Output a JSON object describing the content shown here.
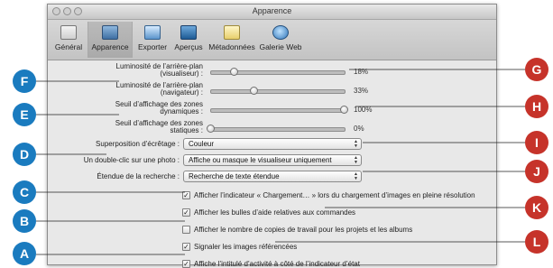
{
  "window": {
    "title": "Apparence"
  },
  "toolbar": {
    "items": [
      {
        "label": "Général",
        "icon": "general-icon"
      },
      {
        "label": "Apparence",
        "icon": "appearance-icon"
      },
      {
        "label": "Exporter",
        "icon": "export-icon"
      },
      {
        "label": "Aperçus",
        "icon": "previews-icon"
      },
      {
        "label": "Métadonnées",
        "icon": "metadata-icon"
      },
      {
        "label": "Galerie Web",
        "icon": "web-gallery-icon"
      }
    ],
    "selected": "Apparence"
  },
  "sliders": [
    {
      "label_line1": "Luminosité de l’arrière-plan",
      "label_line2": "(visualiseur) :",
      "value_text": "18%",
      "level_pct": 18
    },
    {
      "label_line1": "Luminosité de l’arrière-plan",
      "label_line2": "(navigateur) :",
      "value_text": "33%",
      "level_pct": 33
    },
    {
      "label_line1": "Seuil d’affichage des zones",
      "label_line2": "dynamiques :",
      "value_text": "100%",
      "level_pct": 100
    },
    {
      "label_line1": "Seuil d’affichage des zones",
      "label_line2": "statiques :",
      "value_text": "0%",
      "level_pct": 0
    }
  ],
  "popups": [
    {
      "label": "Superposition d’écrêtage :",
      "value": "Couleur"
    },
    {
      "label": "Un double-clic sur une photo :",
      "value": "Affiche ou masque le visualiseur uniquement"
    },
    {
      "label": "Étendue de la recherche :",
      "value": "Recherche de texte étendue"
    }
  ],
  "checkboxes": [
    {
      "label": "Afficher l’indicateur « Chargement… » lors du chargement d’images en pleine résolution",
      "checked": true
    },
    {
      "label": "Afficher les bulles d’aide relatives aux commandes",
      "checked": true
    },
    {
      "label": "Afficher le nombre de copies de travail pour les projets et les albums",
      "checked": false
    },
    {
      "label": "Signaler les images référencées",
      "checked": true
    },
    {
      "label": "Affiche l’intitulé d’activité à côté de l’indicateur d’état",
      "checked": true
    }
  ],
  "callouts": {
    "left": [
      "F",
      "E",
      "D",
      "C",
      "B",
      "A"
    ],
    "right": [
      "G",
      "H",
      "I",
      "J",
      "K",
      "L"
    ],
    "color_left": "#1a7bbf",
    "color_right": "#c6332a"
  }
}
